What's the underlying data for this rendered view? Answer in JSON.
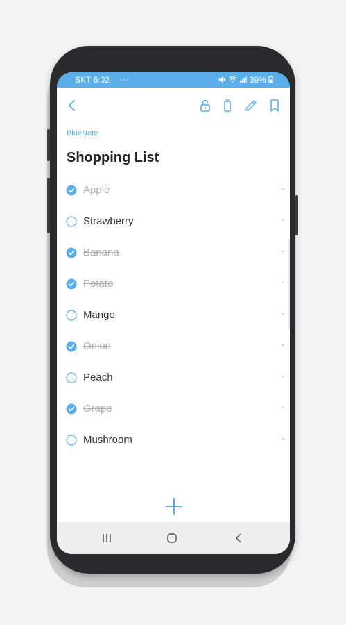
{
  "status_bar": {
    "carrier_time": "SKT 6:02",
    "dots": "···",
    "battery": "39%"
  },
  "toolbar": {
    "back_icon": "chevron-left-icon",
    "icons": [
      "lock-icon",
      "trash-icon",
      "pencil-icon",
      "bookmark-icon"
    ]
  },
  "note": {
    "app_name": "BlueNote",
    "title": "Shopping List"
  },
  "items": [
    {
      "label": "Apple",
      "checked": true,
      "dash": "-"
    },
    {
      "label": "Strawberry",
      "checked": false,
      "dash": "-"
    },
    {
      "label": "Banana",
      "checked": true,
      "dash": "-"
    },
    {
      "label": "Potato",
      "checked": true,
      "dash": "-"
    },
    {
      "label": "Mango",
      "checked": false,
      "dash": "-"
    },
    {
      "label": "Onion",
      "checked": true,
      "dash": "-"
    },
    {
      "label": "Peach",
      "checked": false,
      "dash": "-"
    },
    {
      "label": "Grape",
      "checked": true,
      "dash": "-"
    },
    {
      "label": "Mushroom",
      "checked": false,
      "dash": "-"
    }
  ],
  "colors": {
    "accent": "#5aaeea",
    "checked_text": "#aeaeae",
    "text": "#333333"
  },
  "nav": {
    "icons": [
      "recent-apps-icon",
      "home-icon",
      "back-icon"
    ]
  }
}
